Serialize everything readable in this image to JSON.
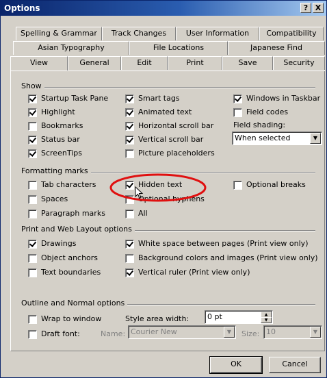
{
  "window": {
    "title": "Options"
  },
  "titlebar_buttons": {
    "help": "?",
    "close": "X"
  },
  "tabs": {
    "row1": [
      "Spelling & Grammar",
      "Track Changes",
      "User Information",
      "Compatibility"
    ],
    "row2": [
      "Asian Typography",
      "File Locations",
      "Japanese Find"
    ],
    "row3": [
      "View",
      "General",
      "Edit",
      "Print",
      "Save",
      "Security"
    ],
    "active": "View"
  },
  "show": {
    "heading": "Show",
    "items": [
      {
        "label": "Startup Task Pane",
        "checked": true
      },
      {
        "label": "Smart tags",
        "checked": true
      },
      {
        "label": "Windows in Taskbar",
        "checked": true
      },
      {
        "label": "Highlight",
        "checked": true
      },
      {
        "label": "Animated text",
        "checked": true
      },
      {
        "label": "Field codes",
        "checked": false
      },
      {
        "label": "Bookmarks",
        "checked": false
      },
      {
        "label": "Horizontal scroll bar",
        "checked": true
      },
      {
        "label": "Status bar",
        "checked": true
      },
      {
        "label": "Vertical scroll bar",
        "checked": true
      },
      {
        "label": "ScreenTips",
        "checked": true
      },
      {
        "label": "Picture placeholders",
        "checked": false
      }
    ],
    "field_shading_label": "Field shading:",
    "field_shading_value": "When selected"
  },
  "formatting_marks": {
    "heading": "Formatting marks",
    "items": [
      {
        "label": "Tab characters",
        "checked": false
      },
      {
        "label": "Hidden text",
        "checked": true
      },
      {
        "label": "Optional breaks",
        "checked": false
      },
      {
        "label": "Spaces",
        "checked": false
      },
      {
        "label": "Optional hyphens",
        "checked": false
      },
      {
        "label": "Paragraph marks",
        "checked": false
      },
      {
        "label": "All",
        "checked": false
      }
    ]
  },
  "print_web": {
    "heading": "Print and Web Layout options",
    "items": [
      {
        "label": "Drawings",
        "checked": true
      },
      {
        "label": "White space between pages (Print view only)",
        "checked": true
      },
      {
        "label": "Object anchors",
        "checked": false
      },
      {
        "label": "Background colors and images (Print view only)",
        "checked": false
      },
      {
        "label": "Text boundaries",
        "checked": false
      },
      {
        "label": "Vertical ruler (Print view only)",
        "checked": true
      }
    ]
  },
  "outline": {
    "heading": "Outline and Normal options",
    "wrap_label": "Wrap to window",
    "wrap_checked": false,
    "style_area_label": "Style area width:",
    "style_area_value": "0 pt",
    "draft_label": "Draft font:",
    "draft_checked": false,
    "name_label": "Name:",
    "name_value": "Courier New",
    "size_label": "Size:",
    "size_value": "10"
  },
  "buttons": {
    "ok": "OK",
    "cancel": "Cancel"
  },
  "annotation_color": "#e01010"
}
